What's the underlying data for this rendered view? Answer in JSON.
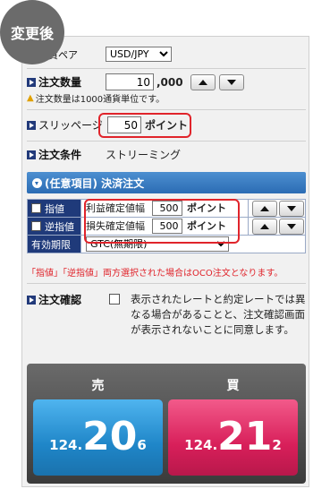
{
  "badge": "変更後",
  "currency_pair": {
    "label": "通貨ペア",
    "value": "USD/JPY"
  },
  "order_quantity": {
    "label": "注文数量",
    "value": "10",
    "suffix": ",000",
    "note": "注文数量は1000通貨単位です。"
  },
  "slippage": {
    "label": "スリッページ",
    "value": "50",
    "unit": "ポイント"
  },
  "order_condition": {
    "label": "注文条件",
    "value": "ストリーミング"
  },
  "optional_section": {
    "title": "(任意項目) 決済注文"
  },
  "limit_row": {
    "checkbox_label": "指値",
    "field_label": "利益確定値幅",
    "value": "500",
    "unit": "ポイント"
  },
  "stop_row": {
    "checkbox_label": "逆指値",
    "field_label": "損失確定値幅",
    "value": "500",
    "unit": "ポイント"
  },
  "expiry": {
    "label": "有効期限",
    "value": "GTC(無期限)"
  },
  "oco_note": "「指値」「逆指値」両方選択された場合はOCO注文となります。",
  "confirm": {
    "label": "注文確認",
    "text": "表示されたレートと約定レートでは異なる場合があることと、注文確認画面が表示されないことに同意します。"
  },
  "sell": {
    "label": "売",
    "price_prefix": "124.",
    "price_main": "20",
    "price_tail": "6"
  },
  "buy": {
    "label": "買",
    "price_prefix": "124.",
    "price_main": "21",
    "price_tail": "2"
  },
  "colors": {
    "highlight": "#e0242b",
    "sell": "#1f86c8",
    "buy": "#d81f5a",
    "navy": "#1f3a7a"
  }
}
